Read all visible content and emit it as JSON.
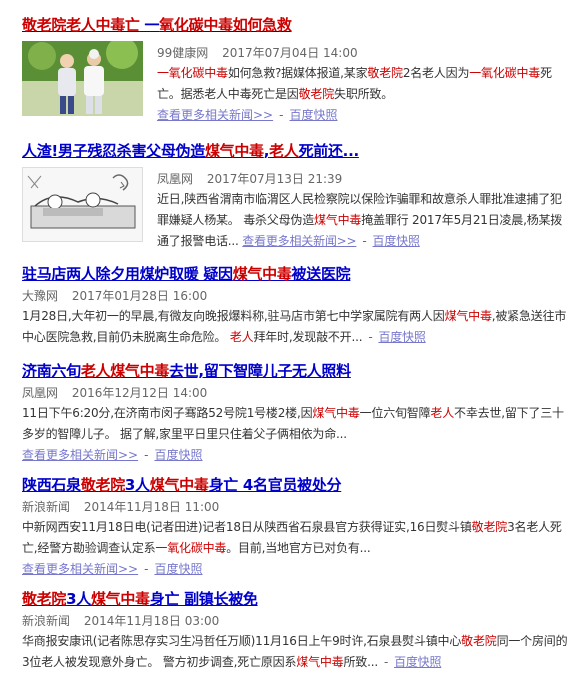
{
  "results": [
    {
      "title_parts": [
        {
          "t": "敬老院老人中毒亡",
          "hl": true
        },
        {
          "t": " 一",
          "hl": false
        },
        {
          "t": "氧化碳中毒如何急救",
          "hl": true
        }
      ],
      "source": "99健康网",
      "date": "2017年07月04日 14:00",
      "snippet_parts": [
        {
          "t": "一氧化碳中毒",
          "hl": true
        },
        {
          "t": "如何急救?据媒体报道,某家",
          "hl": false
        },
        {
          "t": "敬老院",
          "hl": true
        },
        {
          "t": "2名老人因为",
          "hl": false
        },
        {
          "t": "一氧化碳中毒",
          "hl": true
        },
        {
          "t": "死亡。据悉老人中毒死亡是因",
          "hl": false
        },
        {
          "t": "敬老院",
          "hl": true
        },
        {
          "t": "失职所致。",
          "hl": false
        }
      ],
      "more": "查看更多相关新闻>>",
      "snapshot": "百度快照"
    },
    {
      "title_parts": [
        {
          "t": "人渣!男子残忍杀害父母伪造",
          "hl": false
        },
        {
          "t": "煤气中毒",
          "hl": true
        },
        {
          "t": ",",
          "hl": false
        },
        {
          "t": "老人",
          "hl": true
        },
        {
          "t": "死前还...",
          "hl": false
        }
      ],
      "source": "凤凰网",
      "date": "2017年07月13日 21:39",
      "snippet_parts": [
        {
          "t": "近日,陕西省渭南市临渭区人民检察院以保险诈骗罪和故意杀人罪批准逮捕了犯罪嫌疑人杨某。 毒杀父母伪造",
          "hl": false
        },
        {
          "t": "煤气中毒",
          "hl": true
        },
        {
          "t": "掩盖罪行 2017年5月21日凌晨,杨某拨通了报警电话...",
          "hl": false
        }
      ],
      "more": "查看更多相关新闻>>",
      "snapshot": "百度快照"
    },
    {
      "title_parts": [
        {
          "t": "驻马店两人除夕用煤炉取暖 疑因",
          "hl": false
        },
        {
          "t": "煤气中毒",
          "hl": true
        },
        {
          "t": "被送医院",
          "hl": false
        }
      ],
      "source": "大豫网",
      "date": "2017年01月28日 16:00",
      "snippet_parts": [
        {
          "t": "1月28日,大年初一的早晨,有微友向晚报爆料称,驻马店市第七中学家属院有两人因",
          "hl": false
        },
        {
          "t": "煤气中毒",
          "hl": true
        },
        {
          "t": ",被紧急送往市中心医院急救,目前仍未脱离生命危险。 ",
          "hl": false
        },
        {
          "t": "老人",
          "hl": true
        },
        {
          "t": "拜年时,发现敲不开...",
          "hl": false
        }
      ],
      "more": "",
      "snapshot": "百度快照"
    },
    {
      "title_parts": [
        {
          "t": "济南六旬",
          "hl": false
        },
        {
          "t": "老人煤气中毒",
          "hl": true
        },
        {
          "t": "去世,留下智障儿子无人照料",
          "hl": false
        }
      ],
      "source": "凤凰网",
      "date": "2016年12月12日 14:00",
      "snippet_parts": [
        {
          "t": "11日下午6:20分,在济南市闵子骞路52号院1号楼2楼,因",
          "hl": false
        },
        {
          "t": "煤气中毒",
          "hl": true
        },
        {
          "t": "一位六旬智障",
          "hl": false
        },
        {
          "t": "老人",
          "hl": true
        },
        {
          "t": "不幸去世,留下了三十多岁的智障儿子。 据了解,家里平日里只住着父子俩相依为命...",
          "hl": false
        }
      ],
      "more": "查看更多相关新闻>>",
      "snapshot": "百度快照"
    },
    {
      "title_parts": [
        {
          "t": "陕西石泉",
          "hl": false
        },
        {
          "t": "敬老院",
          "hl": true
        },
        {
          "t": "3人",
          "hl": false
        },
        {
          "t": "煤气中毒",
          "hl": true
        },
        {
          "t": "身亡 4名官员被处分",
          "hl": false
        }
      ],
      "source": "新浪新闻",
      "date": "2014年11月18日 11:00",
      "snippet_parts": [
        {
          "t": "中新网西安11月18日电(记者田进)记者18日从陕西省石泉县官方获得证实,16日熨斗镇",
          "hl": false
        },
        {
          "t": "敬老院",
          "hl": true
        },
        {
          "t": "3名老人死亡,经警方勘验调查认定系",
          "hl": false
        },
        {
          "t": "一氧化碳中毒",
          "hl": true
        },
        {
          "t": "。目前,当地官方已对负有...",
          "hl": false
        }
      ],
      "more": "查看更多相关新闻>>",
      "snapshot": "百度快照"
    },
    {
      "title_parts": [
        {
          "t": "敬老院",
          "hl": true
        },
        {
          "t": "3人",
          "hl": false
        },
        {
          "t": "煤气中毒",
          "hl": true
        },
        {
          "t": "身亡 副镇长被免",
          "hl": false
        }
      ],
      "source": "新浪新闻",
      "date": "2014年11月18日 03:00",
      "snippet_parts": [
        {
          "t": "华商报安康讯(记者陈思存实习生冯哲任万顺)11月16日上午9时许,石泉县熨斗镇中心",
          "hl": false
        },
        {
          "t": "敬老院",
          "hl": true
        },
        {
          "t": "同一个房间的3位老人被发现意外身亡。 警方初步调查,死亡原因系",
          "hl": false
        },
        {
          "t": "煤气中毒",
          "hl": true
        },
        {
          "t": "所致...",
          "hl": false
        }
      ],
      "more": "",
      "snapshot": "百度快照"
    }
  ]
}
